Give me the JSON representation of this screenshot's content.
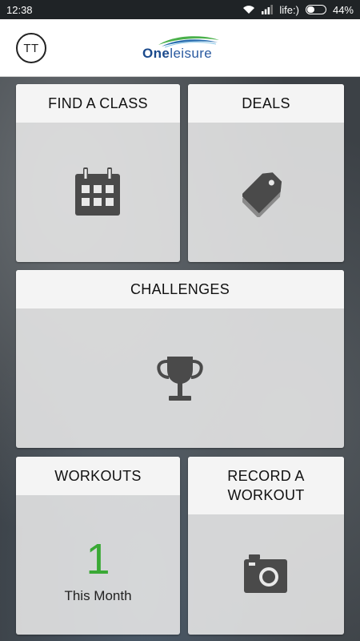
{
  "status_bar": {
    "time": "12:38",
    "carrier": "life:)",
    "battery": "44%",
    "battery_level": 0.44
  },
  "app_bar": {
    "avatar_initials": "TT",
    "logo_text_bold": "One",
    "logo_text_regular": "leisure"
  },
  "tiles": {
    "find_class": {
      "label": "FIND A CLASS",
      "icon": "calendar-icon"
    },
    "deals": {
      "label": "DEALS",
      "icon": "price-tag-icon"
    },
    "challenges": {
      "label": "CHALLENGES",
      "icon": "trophy-icon"
    },
    "workouts": {
      "label": "WORKOUTS",
      "count": "1",
      "caption": "This Month"
    },
    "record_workout": {
      "label_line1": "RECORD A",
      "label_line2": "WORKOUT",
      "icon": "camera-icon"
    }
  },
  "colors": {
    "accent_green": "#3aa935",
    "icon_gray": "#4a4a4a",
    "logo_blue": "#1b4a8c"
  }
}
